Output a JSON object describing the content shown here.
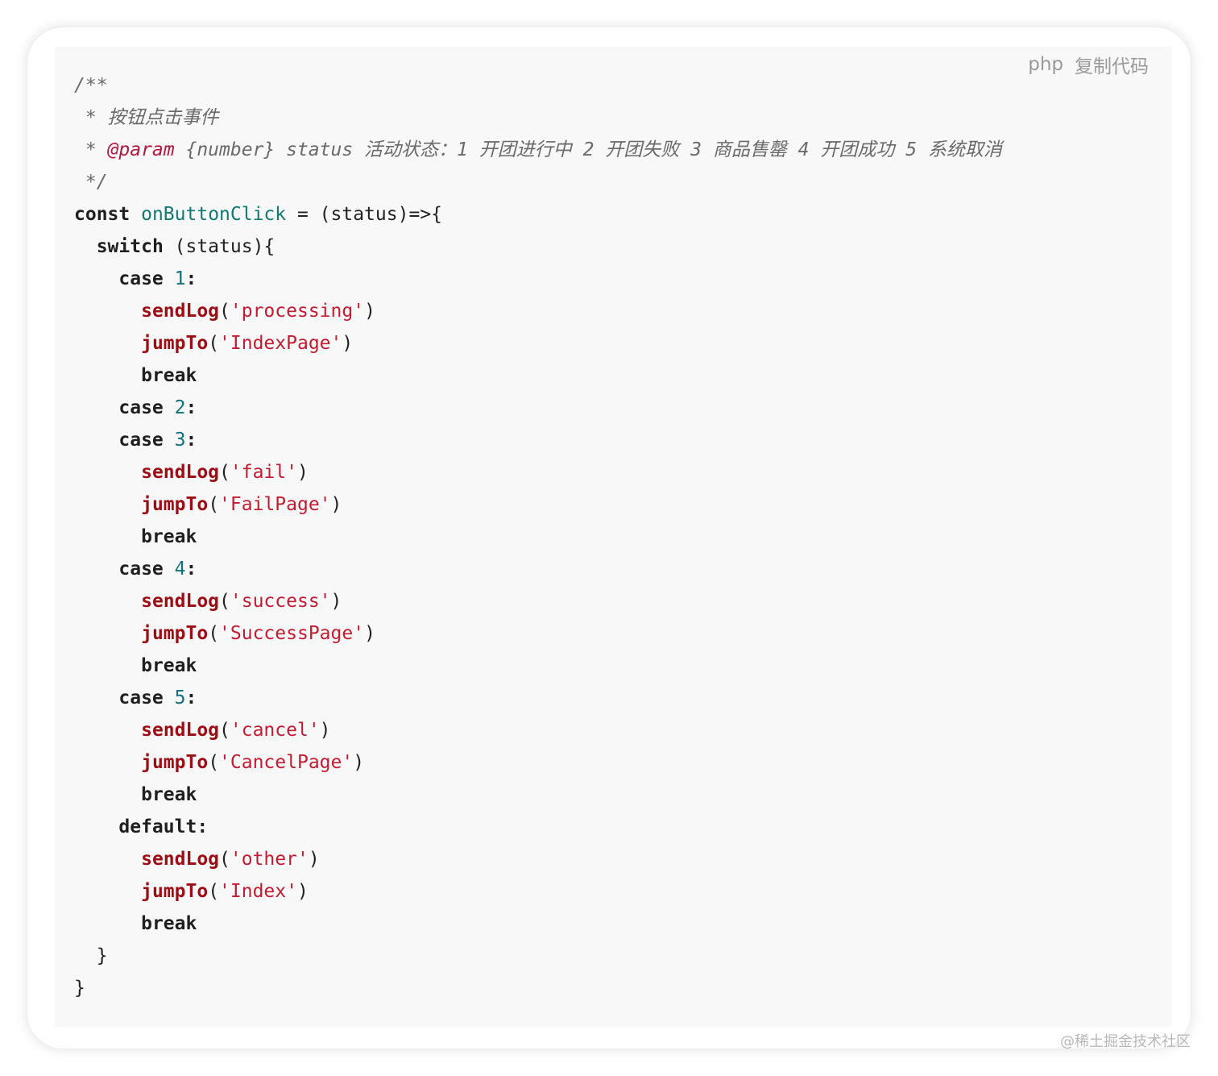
{
  "toolbar": {
    "language": "php",
    "copy_label": "复制代码"
  },
  "watermark": "@稀土掘金技术社区",
  "code_lines": [
    [
      {
        "t": "comment",
        "v": "/**"
      }
    ],
    [
      {
        "t": "comment",
        "v": " * 按钮点击事件"
      }
    ],
    [
      {
        "t": "comment",
        "v": " * "
      },
      {
        "t": "doctag",
        "v": "@param"
      },
      {
        "t": "comment",
        "v": " {number} status 活动状态：1 开团进行中 2 开团失败 3 商品售罄 4 开团成功 5 系统取消"
      }
    ],
    [
      {
        "t": "comment",
        "v": " */"
      }
    ],
    [
      {
        "t": "kw",
        "v": "const"
      },
      {
        "t": "plain",
        "v": " "
      },
      {
        "t": "title",
        "v": "onButtonClick"
      },
      {
        "t": "plain",
        "v": " = (status)=>{"
      }
    ],
    [
      {
        "t": "plain",
        "v": "  "
      },
      {
        "t": "kw",
        "v": "switch"
      },
      {
        "t": "plain",
        "v": " (status){"
      }
    ],
    [
      {
        "t": "plain",
        "v": "    "
      },
      {
        "t": "kw",
        "v": "case"
      },
      {
        "t": "plain",
        "v": " "
      },
      {
        "t": "num",
        "v": "1"
      },
      {
        "t": "kw",
        "v": ":"
      }
    ],
    [
      {
        "t": "plain",
        "v": "      "
      },
      {
        "t": "fn",
        "v": "sendLog"
      },
      {
        "t": "plain",
        "v": "("
      },
      {
        "t": "str",
        "v": "'processing'"
      },
      {
        "t": "plain",
        "v": ")"
      }
    ],
    [
      {
        "t": "plain",
        "v": "      "
      },
      {
        "t": "fn",
        "v": "jumpTo"
      },
      {
        "t": "plain",
        "v": "("
      },
      {
        "t": "str",
        "v": "'IndexPage'"
      },
      {
        "t": "plain",
        "v": ")"
      }
    ],
    [
      {
        "t": "plain",
        "v": "      "
      },
      {
        "t": "kw",
        "v": "break"
      }
    ],
    [
      {
        "t": "plain",
        "v": "    "
      },
      {
        "t": "kw",
        "v": "case"
      },
      {
        "t": "plain",
        "v": " "
      },
      {
        "t": "num",
        "v": "2"
      },
      {
        "t": "kw",
        "v": ":"
      }
    ],
    [
      {
        "t": "plain",
        "v": "    "
      },
      {
        "t": "kw",
        "v": "case"
      },
      {
        "t": "plain",
        "v": " "
      },
      {
        "t": "num",
        "v": "3"
      },
      {
        "t": "kw",
        "v": ":"
      }
    ],
    [
      {
        "t": "plain",
        "v": "      "
      },
      {
        "t": "fn",
        "v": "sendLog"
      },
      {
        "t": "plain",
        "v": "("
      },
      {
        "t": "str",
        "v": "'fail'"
      },
      {
        "t": "plain",
        "v": ")"
      }
    ],
    [
      {
        "t": "plain",
        "v": "      "
      },
      {
        "t": "fn",
        "v": "jumpTo"
      },
      {
        "t": "plain",
        "v": "("
      },
      {
        "t": "str",
        "v": "'FailPage'"
      },
      {
        "t": "plain",
        "v": ")"
      }
    ],
    [
      {
        "t": "plain",
        "v": "      "
      },
      {
        "t": "kw",
        "v": "break"
      }
    ],
    [
      {
        "t": "plain",
        "v": "    "
      },
      {
        "t": "kw",
        "v": "case"
      },
      {
        "t": "plain",
        "v": " "
      },
      {
        "t": "num",
        "v": "4"
      },
      {
        "t": "kw",
        "v": ":"
      }
    ],
    [
      {
        "t": "plain",
        "v": "      "
      },
      {
        "t": "fn",
        "v": "sendLog"
      },
      {
        "t": "plain",
        "v": "("
      },
      {
        "t": "str",
        "v": "'success'"
      },
      {
        "t": "plain",
        "v": ")"
      }
    ],
    [
      {
        "t": "plain",
        "v": "      "
      },
      {
        "t": "fn",
        "v": "jumpTo"
      },
      {
        "t": "plain",
        "v": "("
      },
      {
        "t": "str",
        "v": "'SuccessPage'"
      },
      {
        "t": "plain",
        "v": ")"
      }
    ],
    [
      {
        "t": "plain",
        "v": "      "
      },
      {
        "t": "kw",
        "v": "break"
      }
    ],
    [
      {
        "t": "plain",
        "v": "    "
      },
      {
        "t": "kw",
        "v": "case"
      },
      {
        "t": "plain",
        "v": " "
      },
      {
        "t": "num",
        "v": "5"
      },
      {
        "t": "kw",
        "v": ":"
      }
    ],
    [
      {
        "t": "plain",
        "v": "      "
      },
      {
        "t": "fn",
        "v": "sendLog"
      },
      {
        "t": "plain",
        "v": "("
      },
      {
        "t": "str",
        "v": "'cancel'"
      },
      {
        "t": "plain",
        "v": ")"
      }
    ],
    [
      {
        "t": "plain",
        "v": "      "
      },
      {
        "t": "fn",
        "v": "jumpTo"
      },
      {
        "t": "plain",
        "v": "("
      },
      {
        "t": "str",
        "v": "'CancelPage'"
      },
      {
        "t": "plain",
        "v": ")"
      }
    ],
    [
      {
        "t": "plain",
        "v": "      "
      },
      {
        "t": "kw",
        "v": "break"
      }
    ],
    [
      {
        "t": "plain",
        "v": "    "
      },
      {
        "t": "kw",
        "v": "default:"
      }
    ],
    [
      {
        "t": "plain",
        "v": "      "
      },
      {
        "t": "fn",
        "v": "sendLog"
      },
      {
        "t": "plain",
        "v": "("
      },
      {
        "t": "str",
        "v": "'other'"
      },
      {
        "t": "plain",
        "v": ")"
      }
    ],
    [
      {
        "t": "plain",
        "v": "      "
      },
      {
        "t": "fn",
        "v": "jumpTo"
      },
      {
        "t": "plain",
        "v": "("
      },
      {
        "t": "str",
        "v": "'Index'"
      },
      {
        "t": "plain",
        "v": ")"
      }
    ],
    [
      {
        "t": "plain",
        "v": "      "
      },
      {
        "t": "kw",
        "v": "break"
      }
    ],
    [
      {
        "t": "plain",
        "v": "  }"
      }
    ],
    [
      {
        "t": "plain",
        "v": "}"
      }
    ]
  ]
}
